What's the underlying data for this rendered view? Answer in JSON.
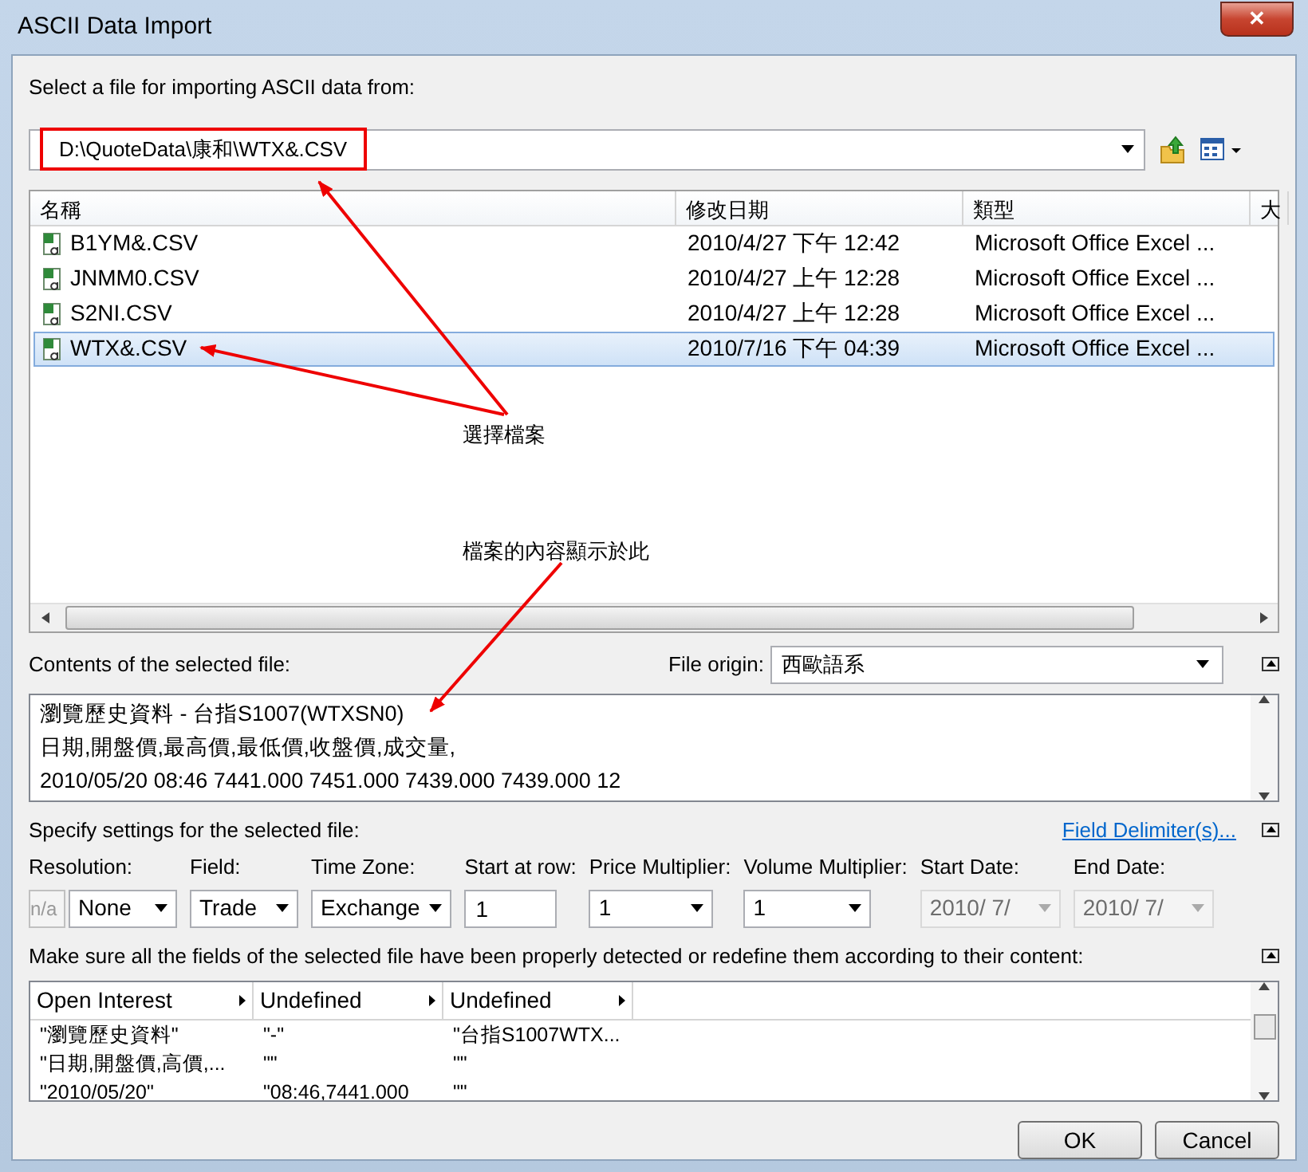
{
  "window": {
    "title": "ASCII Data Import",
    "close": "✕"
  },
  "prompt": "Select a file for importing ASCII data from:",
  "path": {
    "value": "D:\\QuoteData\\康和\\WTX&.CSV",
    "highlighted": true
  },
  "file_list": {
    "columns": [
      "名稱",
      "修改日期",
      "類型",
      "大"
    ],
    "rows": [
      {
        "name": "B1YM&.CSV",
        "modified": "2010/4/27 下午 12:42",
        "type": "Microsoft Office Excel ...",
        "selected": false
      },
      {
        "name": "JNMM0.CSV",
        "modified": "2010/4/27 上午 12:28",
        "type": "Microsoft Office Excel ...",
        "selected": false
      },
      {
        "name": "S2NI.CSV",
        "modified": "2010/4/27 上午 12:28",
        "type": "Microsoft Office Excel ...",
        "selected": false
      },
      {
        "name": "WTX&.CSV",
        "modified": "2010/7/16 下午 04:39",
        "type": "Microsoft Office Excel ...",
        "selected": true
      }
    ]
  },
  "annotations": [
    {
      "text": "選擇檔案",
      "kind": "select-file"
    },
    {
      "text": "檔案的內容顯示於此",
      "kind": "contents"
    }
  ],
  "contents": {
    "label": "Contents of the selected file:",
    "origin_label": "File origin:",
    "origin": "西歐語系",
    "lines": [
      "瀏覽歷史資料 - 台指S1007(WTXSN0)",
      "日期,開盤價,最高價,最低價,收盤價,成交量,",
      "2010/05/20 08:46 7441.000 7451.000 7439.000 7439.000 12"
    ]
  },
  "settings": {
    "label": "Specify settings for the selected file:",
    "link": "Field Delimiter(s)...",
    "fields": [
      {
        "label": "Resolution:",
        "kind": "resolution",
        "prefix": "n/a",
        "value": "None",
        "disabled": false
      },
      {
        "label": "Field:",
        "kind": "select",
        "value": "Trade",
        "disabled": false
      },
      {
        "label": "Time Zone:",
        "kind": "select",
        "value": "Exchange",
        "disabled": false
      },
      {
        "label": "Start at row:",
        "kind": "input",
        "value": "1",
        "disabled": false
      },
      {
        "label": "Price Multiplier:",
        "kind": "select",
        "value": "1",
        "disabled": false
      },
      {
        "label": "Volume Multiplier:",
        "kind": "select",
        "value": "1",
        "disabled": false
      },
      {
        "label": "Start Date:",
        "kind": "select",
        "value": "2010/  7/",
        "disabled": true
      },
      {
        "label": "End Date:",
        "kind": "select",
        "value": "2010/  7/",
        "disabled": true
      }
    ]
  },
  "fields_grid": {
    "label": "Make sure all the fields of the selected file have been properly detected or redefine them according to their content:",
    "columns": [
      "Open Interest",
      "Undefined",
      "Undefined"
    ],
    "rows": [
      [
        "\"瀏覽歷史資料\"",
        "\"-\"",
        "\"台指S1007WTX..."
      ],
      [
        "\"日期,開盤價,高價,...",
        "\"\"",
        "\"\""
      ],
      [
        "\"2010/05/20\"",
        "\"08:46,7441.000",
        "\"\""
      ]
    ]
  },
  "buttons": [
    "OK",
    "Cancel"
  ]
}
